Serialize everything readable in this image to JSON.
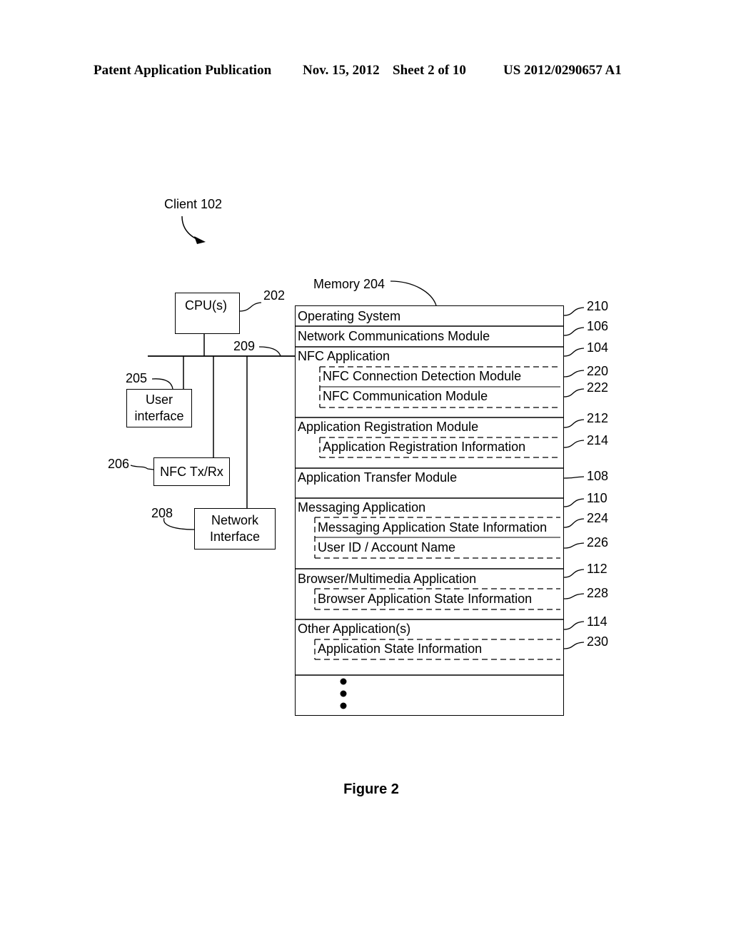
{
  "header": {
    "publication_type": "Patent Application Publication",
    "date": "Nov. 15, 2012",
    "sheet": "Sheet 2 of 10",
    "pub_number": "US 2012/0290657 A1"
  },
  "client_label": "Client 102",
  "components": {
    "cpu": {
      "label": "CPU(s)",
      "ref": "202"
    },
    "bus": {
      "ref": "209"
    },
    "user_interface": {
      "line1": "User",
      "line2": "interface",
      "ref": "205"
    },
    "nfc_txrx": {
      "label": "NFC Tx/Rx",
      "ref": "206"
    },
    "network_interface": {
      "line1": "Network",
      "line2": "Interface",
      "ref": "208"
    }
  },
  "memory": {
    "label": "Memory 204",
    "sections": [
      {
        "label": "Operating System",
        "ref": "210"
      },
      {
        "label": "Network Communications Module",
        "ref": "106"
      },
      {
        "label": "NFC Application",
        "ref": "104"
      },
      {
        "label": "NFC Connection Detection Module",
        "ref": "220",
        "sub": true
      },
      {
        "label": "NFC Communication Module",
        "ref": "222",
        "sub": true
      },
      {
        "label": "Application Registration Module",
        "ref": "212"
      },
      {
        "label": "Application Registration Information",
        "ref": "214",
        "sub": true
      },
      {
        "label": "Application Transfer Module",
        "ref": "108"
      },
      {
        "label": "Messaging Application",
        "ref": "110"
      },
      {
        "label": "Messaging Application State Information",
        "ref": "224",
        "sub": true
      },
      {
        "label": "User ID / Account Name",
        "ref": "226",
        "sub": true
      },
      {
        "label": "Browser/Multimedia Application",
        "ref": "112"
      },
      {
        "label": "Browser Application State Information",
        "ref": "228",
        "sub": true
      },
      {
        "label": "Other Application(s)",
        "ref": "114"
      },
      {
        "label": "Application State Information",
        "ref": "230",
        "sub": true
      }
    ],
    "continuation": "ellipsis-vertical"
  },
  "figure_caption": "Figure 2"
}
